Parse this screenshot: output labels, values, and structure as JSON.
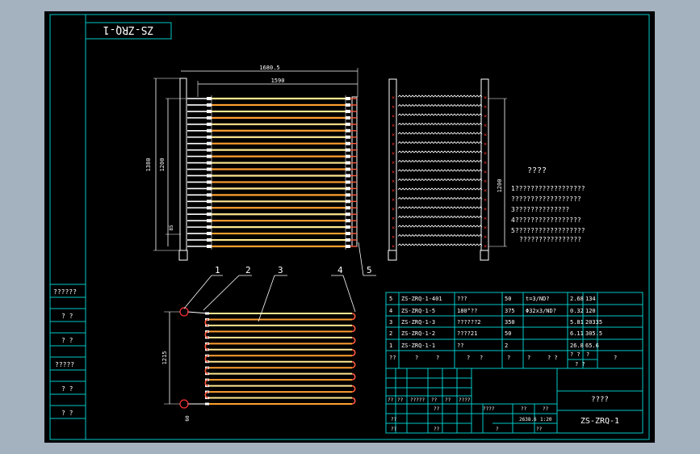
{
  "title_block_rotated": "ZS-ZRQ-1",
  "notes": {
    "heading": "????",
    "lines": [
      "1??????????????????",
      "??????????????????",
      "3??????????????",
      "4?????????????????",
      "5??????????????????",
      "????????????????"
    ]
  },
  "side_revisions": [
    "??????",
    "? ?",
    "? ?",
    "?????",
    "? ?",
    "? ?"
  ],
  "dimensions": {
    "top_outer": "1680.5",
    "top_inner": "1590",
    "left_outer": "1380",
    "left_inner": "1200",
    "left_small": "85",
    "right_height": "1200",
    "bottom_height": "1215",
    "bottom_small": "60"
  },
  "callouts": [
    "1",
    "2",
    "3",
    "4",
    "5"
  ],
  "bom": {
    "rows": [
      [
        "5",
        "ZS-ZRQ-1-401",
        "???",
        "50",
        "t=3/ND?",
        "2.68",
        "134"
      ],
      [
        "4",
        "ZS-ZRQ-1-5",
        "180°??",
        "375",
        "Φ32x3/ND?",
        "0.32",
        "120"
      ],
      [
        "3",
        "ZS-ZRQ-1-3",
        "??????2",
        "350",
        "",
        "5.81",
        "20335"
      ],
      [
        "2",
        "ZS-ZRQ-1-2",
        "????21",
        "50",
        "",
        "6.11",
        "305.5"
      ],
      [
        "1",
        "ZS-ZRQ-1-1",
        "??",
        "2",
        "",
        "26.8",
        "65.6"
      ]
    ],
    "header": [
      "??",
      "?",
      "?",
      "?",
      "?",
      "?",
      "?",
      "? ?",
      "? ?",
      "?",
      "?"
    ]
  },
  "title_block": {
    "drawing_name": "????",
    "drawing_no": "ZS-ZRQ-1",
    "weight": "2638.6",
    "scale": "1:20",
    "cells": [
      "??",
      "??",
      "?????",
      "??",
      "??",
      "????",
      "??",
      "??",
      "??",
      "????",
      "??",
      "??",
      "??",
      "?",
      "??"
    ]
  }
}
